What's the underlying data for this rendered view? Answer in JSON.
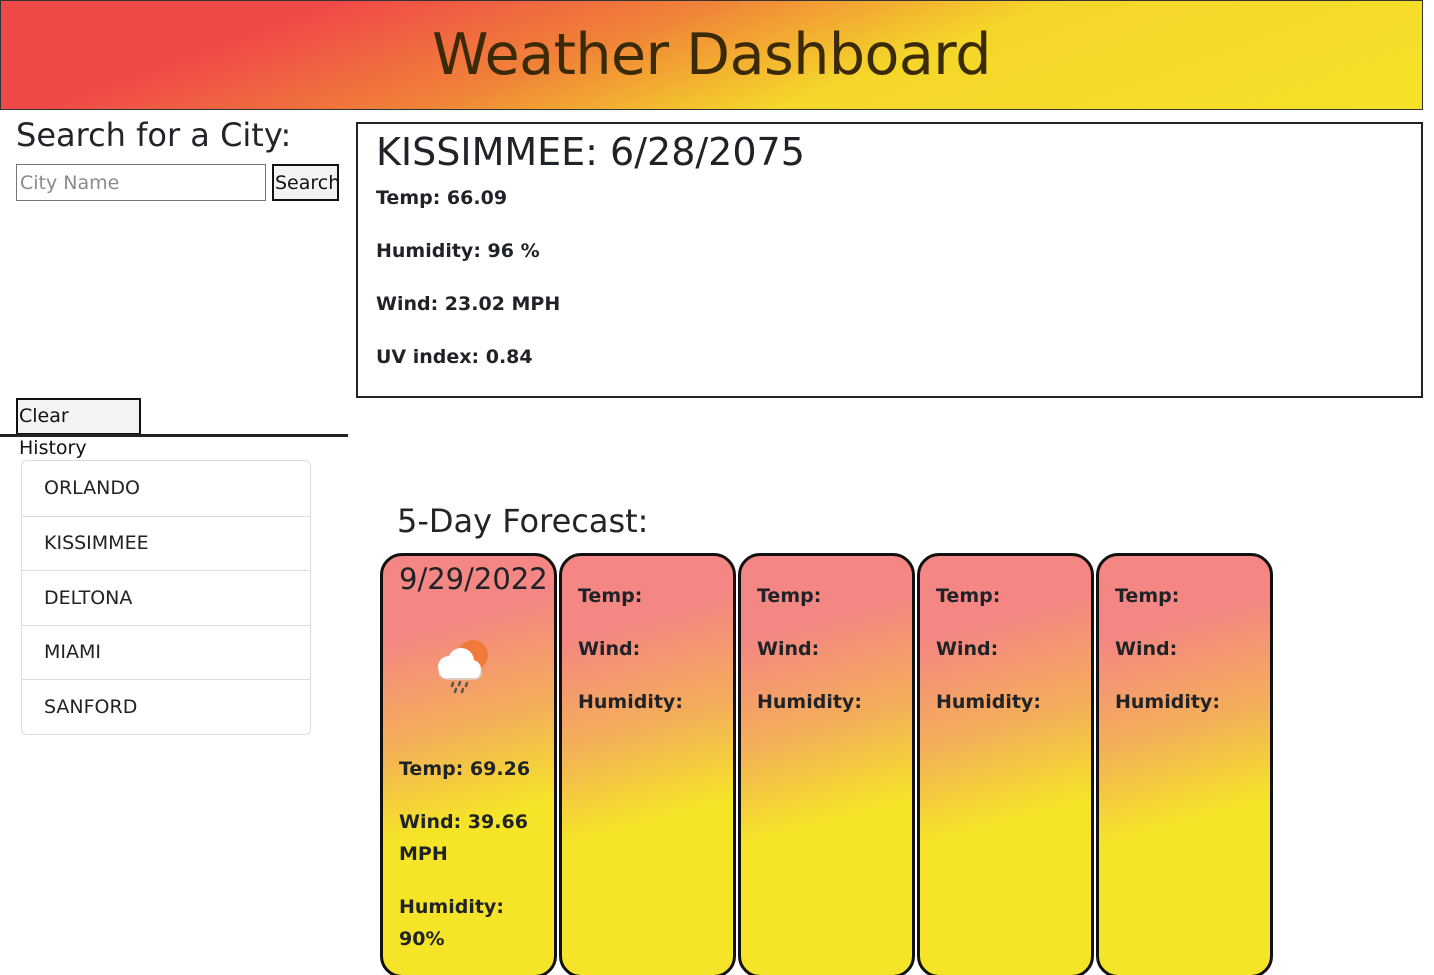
{
  "header": {
    "title": "Weather Dashboard"
  },
  "search": {
    "title": "Search for a City:",
    "placeholder": "City Name",
    "button_label": "Search",
    "clear_label": "Clear History"
  },
  "history": [
    "ORLANDO",
    "KISSIMMEE",
    "DELTONA",
    "MIAMI",
    "SANFORD"
  ],
  "current": {
    "heading": "KISSIMMEE: 6/28/2075",
    "temp": "Temp: 66.09",
    "humidity": "Humidity: 96 %",
    "wind": "Wind: 23.02 MPH",
    "uv": "UV index: 0.84"
  },
  "forecast": {
    "title": "5-Day Forecast:",
    "days": [
      {
        "date": "9/29/2022",
        "icon": "rain-cloud-sun-icon",
        "temp": "Temp: 69.26",
        "wind_1": "Wind: 39.66",
        "wind_2": "MPH",
        "humidity_1": "Humidity:",
        "humidity_2": "90%"
      },
      {
        "temp": "Temp:",
        "wind": "Wind:",
        "humidity": "Humidity:"
      },
      {
        "temp": "Temp:",
        "wind": "Wind:",
        "humidity": "Humidity:"
      },
      {
        "temp": "Temp:",
        "wind": "Wind:",
        "humidity": "Humidity:"
      },
      {
        "temp": "Temp:",
        "wind": "Wind:",
        "humidity": "Humidity:"
      }
    ]
  }
}
